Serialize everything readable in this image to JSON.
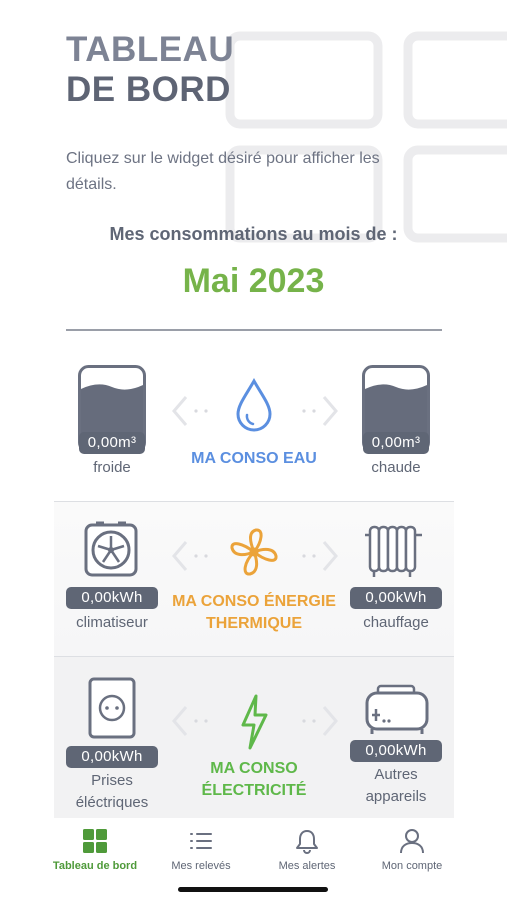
{
  "header": {
    "title_line1": "TABLEAU",
    "title_line2": "DE BORD",
    "subtitle": "Cliquez sur le widget désiré pour afficher les détails.",
    "month_label": "Mes consommations au mois de :",
    "month": "Mai 2023"
  },
  "widgets": {
    "water": {
      "title": "MA CONSO EAU",
      "left_value": "0,00m³",
      "left_label": "froide",
      "right_value": "0,00m³",
      "right_label": "chaude",
      "accent": "#5b8fe0"
    },
    "thermal": {
      "title_line1": "MA CONSO ÉNERGIE",
      "title_line2": "THERMIQUE",
      "left_value": "0,00kWh",
      "left_label": "climatiseur",
      "right_value": "0,00kWh",
      "right_label": "chauffage",
      "accent": "#eba33a"
    },
    "electricity": {
      "title_line1": "MA CONSO",
      "title_line2": "ÉLECTRICITÉ",
      "left_value": "0,00kWh",
      "left_label_line1": "Prises",
      "left_label_line2": "éléctriques",
      "right_value": "0,00kWh",
      "right_label_line1": "Autres",
      "right_label_line2": "appareils",
      "accent": "#5fb84a"
    }
  },
  "tabbar": {
    "items": [
      {
        "label": "Tableau de bord",
        "icon": "dashboard-grid-icon",
        "active": true
      },
      {
        "label": "Mes relevés",
        "icon": "list-icon",
        "active": false
      },
      {
        "label": "Mes alertes",
        "icon": "bell-icon",
        "active": false
      },
      {
        "label": "Mon compte",
        "icon": "user-icon",
        "active": false
      }
    ],
    "active_color": "#4f9a3a"
  }
}
